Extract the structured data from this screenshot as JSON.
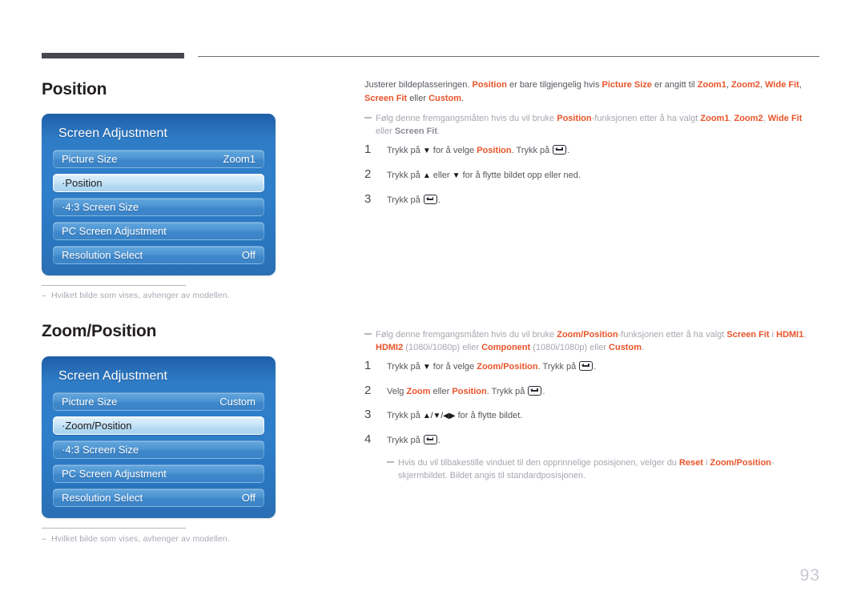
{
  "page": {
    "number": "93"
  },
  "sections": [
    {
      "title": "Position",
      "osd": {
        "title": "Screen Adjustment",
        "rows": [
          {
            "label": "Picture Size",
            "value": "Zoom1",
            "selected": false
          },
          {
            "label": "·Position",
            "value": "",
            "selected": true
          },
          {
            "label": "·4:3 Screen Size",
            "value": "",
            "selected": false
          },
          {
            "label": "PC Screen Adjustment",
            "value": "",
            "selected": false
          },
          {
            "label": "Resolution Select",
            "value": "Off",
            "selected": false
          }
        ]
      },
      "footnote": "Hvilket bilde som vises, avhenger av modellen.",
      "intro": {
        "t1": "Justerer bildeplasseringen. ",
        "h1": "Position",
        "t2": " er bare tilgjengelig hvis ",
        "h2": "Picture Size",
        "t3": " er angitt til ",
        "h3": "Zoom1",
        "t4": ", ",
        "h4": "Zoom2",
        "t5": ", ",
        "h5": "Wide Fit",
        "t6": ", ",
        "h6": "Screen Fit",
        "t7": " eller ",
        "h7": "Custom",
        "t8": "."
      },
      "note": {
        "t1": "Følg denne fremgangsmåten hvis du vil bruke ",
        "h1": "Position",
        "t2": "-funksjonen etter å ha valgt ",
        "h2": "Zoom1",
        "t3": ", ",
        "h3": "Zoom2",
        "t4": ", ",
        "h4": "Wide Fit",
        "t5": " eller ",
        "h5": "Screen Fit",
        "t6": "."
      },
      "steps": [
        {
          "num": "1",
          "a": "Trykk på ",
          "arrow": "▼",
          "b": " for å velge ",
          "hl": "Position",
          "c": ". Trykk på ",
          "d": ".",
          "has_key": true
        },
        {
          "num": "2",
          "a": "Trykk på ",
          "arrow": "▲",
          "b": " eller ",
          "arrow2": "▼",
          "c": " for å flytte bildet opp eller ned.",
          "has_key": false
        },
        {
          "num": "3",
          "a": "Trykk på ",
          "d": ".",
          "has_key": true
        }
      ]
    },
    {
      "title": "Zoom/Position",
      "osd": {
        "title": "Screen Adjustment",
        "rows": [
          {
            "label": "Picture Size",
            "value": "Custom",
            "selected": false
          },
          {
            "label": "·Zoom/Position",
            "value": "",
            "selected": true
          },
          {
            "label": "·4:3 Screen Size",
            "value": "",
            "selected": false
          },
          {
            "label": "PC Screen Adjustment",
            "value": "",
            "selected": false
          },
          {
            "label": "Resolution Select",
            "value": "Off",
            "selected": false
          }
        ]
      },
      "footnote": "Hvilket bilde som vises, avhenger av modellen.",
      "note": {
        "t1": "Følg denne fremgangsmåten hvis du vil bruke ",
        "h1": "Zoom/Position",
        "t2": "-funksjonen etter å ha valgt ",
        "h2": "Screen Fit",
        "t3": " i ",
        "h3": "HDMI1",
        "t4": ", ",
        "h4": "HDMI2",
        "t5": " (1080i/1080p) eller ",
        "h5": "Component",
        "t6": " (1080i/1080p) eller ",
        "h6": "Custom",
        "t7": "."
      },
      "steps": [
        {
          "num": "1",
          "a": "Trykk på ",
          "arrow": "▼",
          "b": " for å velge ",
          "hl": "Zoom/Position",
          "c": ". Trykk på ",
          "d": ".",
          "has_key": true
        },
        {
          "num": "2",
          "a": "Velg ",
          "hl": "Zoom",
          "b": " eller ",
          "hl2": "Position",
          "c": ". Trykk på ",
          "d": ".",
          "has_key": true
        },
        {
          "num": "3",
          "a": "Trykk på ",
          "arrow": "▲/▼/◀▶",
          "c": " for å flytte bildet.",
          "has_key": false
        },
        {
          "num": "4",
          "a": "Trykk på ",
          "d": ".",
          "has_key": true
        }
      ],
      "endnote": {
        "t1": "Hvis du vil tilbakestille vinduet til den opprinnelige posisjonen, velger du ",
        "h1": "Reset",
        "t2": " i ",
        "h2": "Zoom/Position",
        "t3": "-skjermbildet. Bildet angis til standardposisjonen."
      }
    }
  ],
  "colors": {
    "accent": "#e8542a",
    "heading": "#231f20",
    "body": "#58565e",
    "muted": "#a8a6b0",
    "osd_blue": "#2e7fcb",
    "rule_dark": "#494551"
  }
}
